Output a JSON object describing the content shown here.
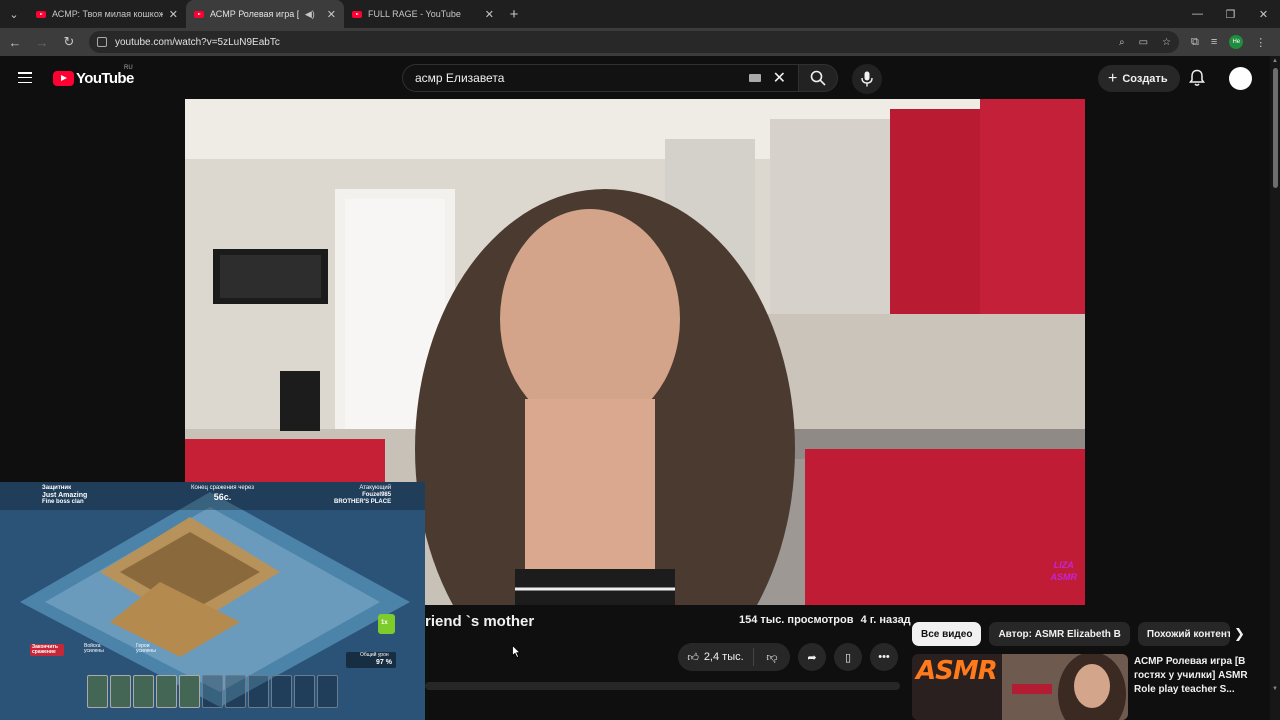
{
  "browser": {
    "tabs": [
      {
        "title": "АСМР: Твоя милая кошкожена",
        "active": false
      },
      {
        "title": "АСМР Ролевая игра [Мама",
        "active": true,
        "audio": true
      },
      {
        "title": "FULL RAGE - YouTube",
        "active": false
      }
    ],
    "url": "youtube.com/watch?v=5zLuN9EabTc",
    "profile_initials": "Не"
  },
  "youtube": {
    "logo_text": "YouTube",
    "region": "RU",
    "search_query": "асмр Елизавета",
    "create_label": "Создать"
  },
  "video": {
    "watermark_line1": "LIZA",
    "watermark_line2": "ASMR",
    "title_visible_tail": "riend `s mother",
    "views": "154 тыс. просмотров",
    "age": "4 г. назад",
    "likes": "2,4 тыс."
  },
  "game_overlay": {
    "left_player_label": "Защитник",
    "left_player_name": "Just Amazing",
    "left_clan": "Fine boss clan",
    "timer_label": "Конец сражения через",
    "timer": "56с.",
    "right_player_label": "Атакующий",
    "right_player_name": "Fouzel985",
    "right_clan": "BROTHER'S PLACE",
    "end_battle_label": "Закончить сражение",
    "army_label": "Войска усилены",
    "heroes_label": "Герои усилены",
    "total_damage_label": "Общий урон",
    "damage_percent": "97 %",
    "boost_badge": "1x"
  },
  "sidebar": {
    "chips": [
      "Все видео",
      "Автор: ASMR Elizabeth B",
      "Похожий контент"
    ],
    "recommendation": {
      "thumb_label": "ASMR",
      "title": "АСМР Ролевая игра [В гостях у училки] ASMR Role play teacher S..."
    }
  },
  "colors": {
    "yt_red": "#ff0033",
    "bg": "#0f0f0f",
    "chip_bg": "#272727"
  }
}
